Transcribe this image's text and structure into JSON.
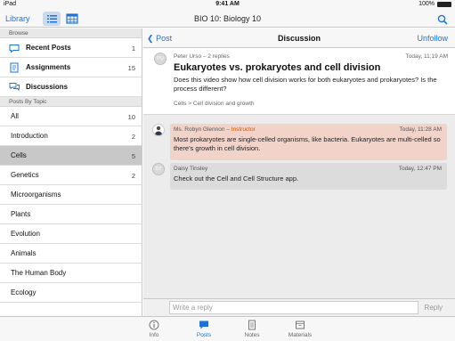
{
  "status": {
    "carrier": "iPad",
    "time": "9:41 AM",
    "battery": "100%"
  },
  "navbar": {
    "library": "Library",
    "title": "BIO 10: Biology 10"
  },
  "sidebar": {
    "browse_header": "Browse",
    "browse": [
      {
        "label": "Recent Posts",
        "count": "1",
        "icon": "chat-bubble-icon"
      },
      {
        "label": "Assignments",
        "count": "15",
        "icon": "assignment-icon"
      },
      {
        "label": "Discussions",
        "count": "",
        "icon": "discussion-icon"
      }
    ],
    "topics_header": "Posts By Topic",
    "topics": [
      {
        "label": "All",
        "count": "10"
      },
      {
        "label": "Introduction",
        "count": "2"
      },
      {
        "label": "Cells",
        "count": "5",
        "selected": true
      },
      {
        "label": "Genetics",
        "count": "2"
      },
      {
        "label": "Microorganisms",
        "count": ""
      },
      {
        "label": "Plants",
        "count": ""
      },
      {
        "label": "Evolution",
        "count": ""
      },
      {
        "label": "Animals",
        "count": ""
      },
      {
        "label": "The Human Body",
        "count": ""
      },
      {
        "label": "Ecology",
        "count": ""
      }
    ]
  },
  "main": {
    "back": "Post",
    "title": "Discussion",
    "unfollow": "Unfollow"
  },
  "post": {
    "initials": "PU",
    "author": "Peter Urso – 2 replies",
    "time": "Today, 11:19 AM",
    "title": "Eukaryotes vs. prokaryotes and cell division",
    "body": "Does this video show how cell division works for both eukaryotes and prokaryotes? Is the process different?",
    "breadcrumb": "Cells > Cell division and growth"
  },
  "replies": [
    {
      "author": "Ms. Robyn Glennon",
      "role": " – Instructor",
      "time": "Today, 11:28 AM",
      "body": "Most prokaryotes are single-celled organisms, like bacteria. Eukaryotes are multi-celled so there's growth in cell division."
    },
    {
      "initials": "DT",
      "author": "Daisy Tinsley",
      "role": "",
      "time": "Today, 12:47 PM",
      "body": "Check out the Cell and Cell Structure app."
    }
  ],
  "composer": {
    "placeholder": "Write a reply",
    "button": "Reply"
  },
  "tabs": [
    {
      "label": "Info",
      "icon": "info-icon"
    },
    {
      "label": "Posts",
      "icon": "posts-icon",
      "active": true
    },
    {
      "label": "Notes",
      "icon": "notes-icon"
    },
    {
      "label": "Materials",
      "icon": "materials-icon"
    }
  ],
  "colors": {
    "accent": "#1a73d9",
    "instructor_bg": "#f2d3c9",
    "instructor_role": "#d35400",
    "selected_row": "#c8c8c8"
  }
}
